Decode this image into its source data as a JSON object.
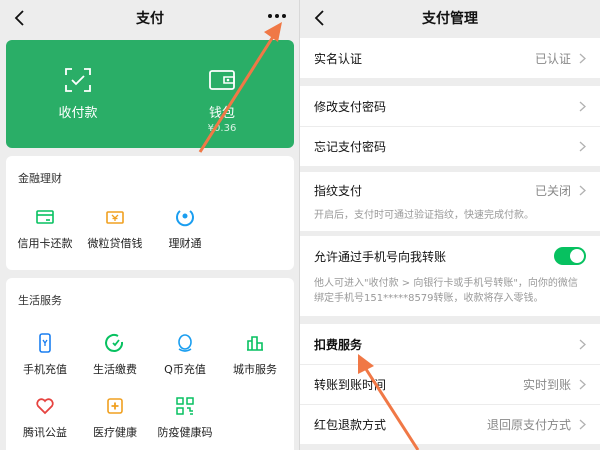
{
  "left_screen": {
    "title": "支付",
    "wallet_card": {
      "receive_pay": "收付款",
      "wallet": "钱包",
      "wallet_balance": "¥0.36"
    },
    "finance": {
      "title": "金融理财",
      "items": [
        {
          "label": "信用卡还款",
          "icon": "credit-card-icon"
        },
        {
          "label": "微粒贷借钱",
          "icon": "loan-icon"
        },
        {
          "label": "理财通",
          "icon": "wealth-icon"
        }
      ]
    },
    "life": {
      "title": "生活服务",
      "items": [
        {
          "label": "手机充值",
          "icon": "phone-icon"
        },
        {
          "label": "生活缴费",
          "icon": "utility-icon"
        },
        {
          "label": "Q币充值",
          "icon": "qq-icon"
        },
        {
          "label": "城市服务",
          "icon": "city-icon"
        },
        {
          "label": "腾讯公益",
          "icon": "charity-icon"
        },
        {
          "label": "医疗健康",
          "icon": "medical-icon"
        },
        {
          "label": "防疫健康码",
          "icon": "qr-icon"
        }
      ]
    }
  },
  "right_screen": {
    "title": "支付管理",
    "rows": {
      "real_name": {
        "label": "实名认证",
        "value": "已认证"
      },
      "modify_pwd": {
        "label": "修改支付密码"
      },
      "forgot_pwd": {
        "label": "忘记支付密码"
      },
      "fingerprint": {
        "label": "指纹支付",
        "value": "已关闭",
        "desc": "开启后，支付时可通过验证指纹，快速完成付款。"
      },
      "phone_transfer": {
        "label": "允许通过手机号向我转账",
        "desc": "他人可进入\"收付款 > 向银行卡或手机号转账\"，向你的微信绑定手机号151*****8579转账，收款将存入零钱。",
        "enabled": true
      },
      "deduction": {
        "label": "扣费服务"
      },
      "transfer_time": {
        "label": "转账到账时间",
        "value": "实时到账"
      },
      "redpacket_refund": {
        "label": "红包退款方式",
        "value": "退回原支付方式"
      }
    }
  },
  "colors": {
    "wechat_green": "#2aae67",
    "toggle_green": "#07c160",
    "annotation_arrow": "#f07846"
  }
}
